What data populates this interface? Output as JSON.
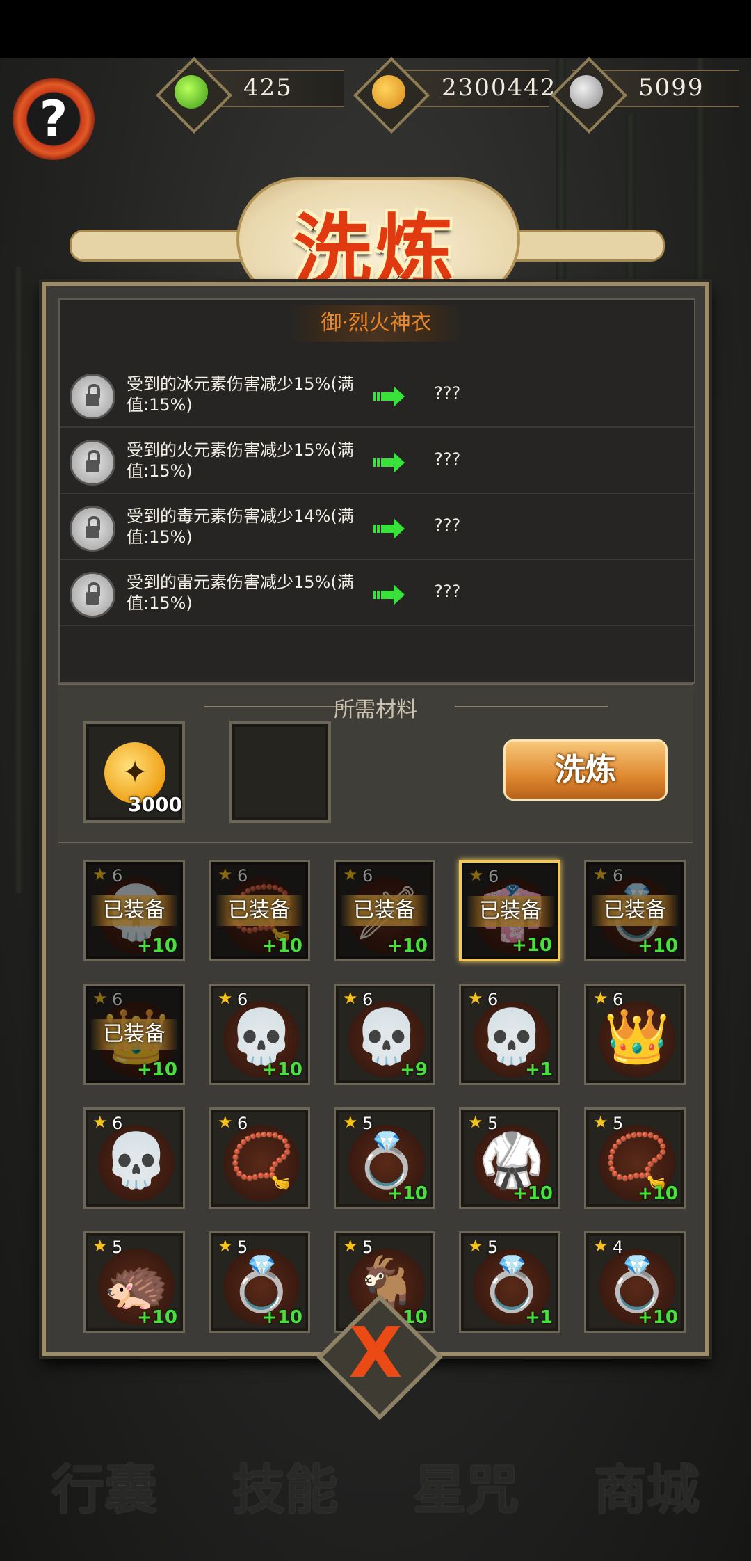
{
  "resources": [
    {
      "icon": "green-gem-icon",
      "value": "425"
    },
    {
      "icon": "gold-coin-icon",
      "value": "2300442"
    },
    {
      "icon": "silver-coin-icon",
      "value": "5099"
    }
  ],
  "help_label": "?",
  "title": "洗炼",
  "item_name": "御·烈火神衣",
  "attributes": [
    {
      "text": "受到的冰元素伤害减少15%(满值:15%)",
      "new_value": "???"
    },
    {
      "text": "受到的火元素伤害减少15%(满值:15%)",
      "new_value": "???"
    },
    {
      "text": "受到的毒元素伤害减少14%(满值:15%)",
      "new_value": "???"
    },
    {
      "text": "受到的雷元素伤害减少15%(满值:15%)",
      "new_value": "???"
    }
  ],
  "materials": {
    "label": "所需材料",
    "coin_qty": "3000",
    "refine_button": "洗炼"
  },
  "equipped_label": "已装备",
  "inventory": [
    {
      "stars": "6",
      "plus": "+10",
      "equipped": true,
      "art": "💀"
    },
    {
      "stars": "6",
      "plus": "+10",
      "equipped": true,
      "art": "📿"
    },
    {
      "stars": "6",
      "plus": "+10",
      "equipped": true,
      "art": "🗡"
    },
    {
      "stars": "6",
      "plus": "+10",
      "equipped": true,
      "art": "👘",
      "selected": true
    },
    {
      "stars": "6",
      "plus": "+10",
      "equipped": true,
      "art": "💍"
    },
    {
      "stars": "6",
      "plus": "+10",
      "equipped": true,
      "art": "👑"
    },
    {
      "stars": "6",
      "plus": "+10",
      "equipped": false,
      "art": "💀"
    },
    {
      "stars": "6",
      "plus": "+9",
      "equipped": false,
      "art": "💀"
    },
    {
      "stars": "6",
      "plus": "+1",
      "equipped": false,
      "art": "💀"
    },
    {
      "stars": "6",
      "plus": "",
      "equipped": false,
      "art": "👑"
    },
    {
      "stars": "6",
      "plus": "",
      "equipped": false,
      "art": "💀"
    },
    {
      "stars": "6",
      "plus": "",
      "equipped": false,
      "art": "📿"
    },
    {
      "stars": "5",
      "plus": "+10",
      "equipped": false,
      "art": "💍"
    },
    {
      "stars": "5",
      "plus": "+10",
      "equipped": false,
      "art": "🥋"
    },
    {
      "stars": "5",
      "plus": "+10",
      "equipped": false,
      "art": "📿"
    },
    {
      "stars": "5",
      "plus": "+10",
      "equipped": false,
      "art": "🦔"
    },
    {
      "stars": "5",
      "plus": "+10",
      "equipped": false,
      "art": "💍"
    },
    {
      "stars": "5",
      "plus": "+10",
      "equipped": false,
      "art": "🐐"
    },
    {
      "stars": "5",
      "plus": "+1",
      "equipped": false,
      "art": "💍"
    },
    {
      "stars": "4",
      "plus": "+10",
      "equipped": false,
      "art": "💍"
    }
  ],
  "close_label": "X",
  "bottom_nav": [
    "行囊",
    "技能",
    "星咒",
    "商城"
  ],
  "colors": {
    "accent": "#e23a10",
    "plus": "#48e03a",
    "star": "#f7c21a",
    "arrow": "#38e23a"
  }
}
